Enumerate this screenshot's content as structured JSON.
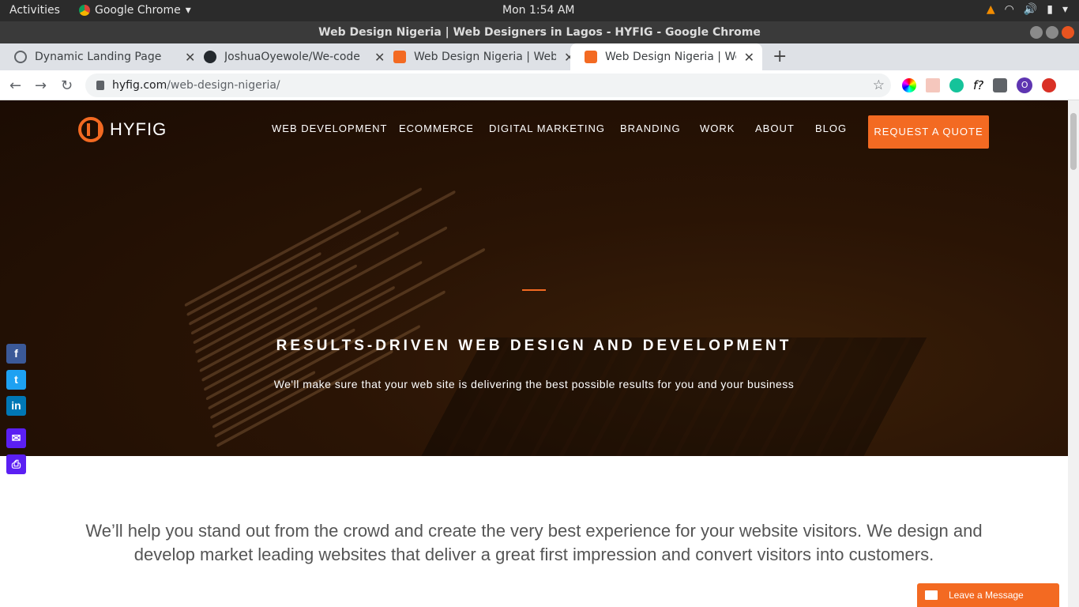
{
  "os": {
    "activities": "Activities",
    "app_name": "Google Chrome",
    "clock": "Mon  1:54 AM"
  },
  "window": {
    "title": "Web Design Nigeria | Web Designers in Lagos - HYFIG - Google Chrome"
  },
  "tabs": [
    {
      "label": "Dynamic Landing Page",
      "icon": "globe-icon"
    },
    {
      "label": "JoshuaOyewole/We-code",
      "icon": "github-icon"
    },
    {
      "label": "Web Design Nigeria | Web",
      "icon": "hyfig-favicon"
    },
    {
      "label": "Web Design Nigeria | Web",
      "icon": "hyfig-favicon"
    }
  ],
  "address": {
    "domain": "hyfig.com",
    "path": "/web-design-nigeria/"
  },
  "site": {
    "logo_text": "HYFIG",
    "nav": [
      "WEB DEVELOPMENT",
      "ECOMMERCE",
      "DIGITAL MARKETING",
      "BRANDING",
      "WORK",
      "ABOUT",
      "BLOG"
    ],
    "cta": "REQUEST A QUOTE",
    "hero_title": "RESULTS-DRIVEN WEB DESIGN AND DEVELOPMENT",
    "hero_subtitle": "We'll make sure that your web site is delivering the best possible results for you and your business",
    "intro": "We’ll help you stand out from the crowd and create the very best experience for your website visitors. We design and develop market leading websites that deliver a great first impression and convert visitors into customers.",
    "chat_label": "Leave a Message"
  },
  "share_buttons": [
    "facebook",
    "twitter",
    "linkedin",
    "email",
    "print"
  ],
  "colors": {
    "accent": "#f36a22",
    "facebook": "#3b5998",
    "twitter": "#1da1f2",
    "linkedin": "#0077b5",
    "email": "#5b1ff3",
    "print": "#5b1ff3"
  }
}
